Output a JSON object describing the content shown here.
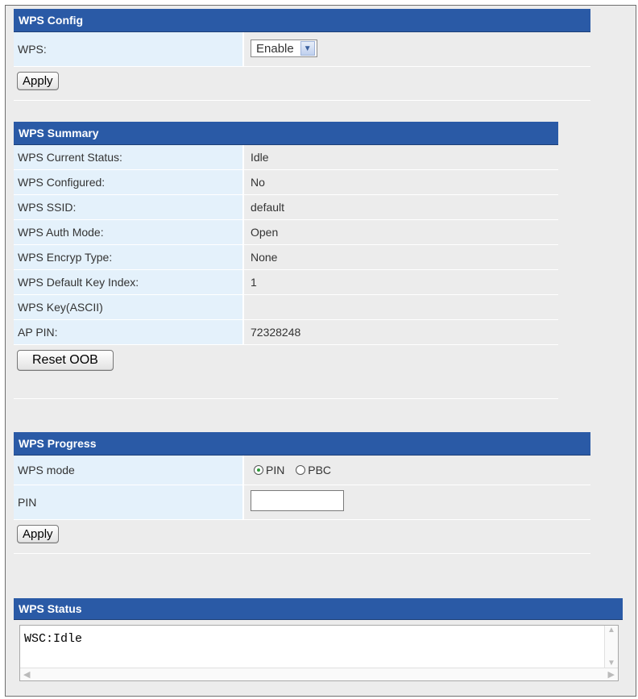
{
  "wps_config": {
    "title": "WPS Config",
    "wps_label": "WPS:",
    "wps_value": "Enable",
    "apply_label": "Apply"
  },
  "wps_summary": {
    "title": "WPS Summary",
    "rows": [
      {
        "label": "WPS Current Status:",
        "value": "Idle"
      },
      {
        "label": "WPS Configured:",
        "value": "No"
      },
      {
        "label": "WPS SSID:",
        "value": "default"
      },
      {
        "label": "WPS Auth Mode:",
        "value": "Open"
      },
      {
        "label": "WPS Encryp Type:",
        "value": "None"
      },
      {
        "label": "WPS Default Key Index:",
        "value": "1"
      },
      {
        "label": "WPS Key(ASCII)",
        "value": ""
      },
      {
        "label": "AP PIN:",
        "value": "72328248"
      }
    ],
    "reset_label": "Reset OOB"
  },
  "wps_progress": {
    "title": "WPS Progress",
    "mode_label": "WPS mode",
    "mode_options": [
      "PIN",
      "PBC"
    ],
    "mode_selected": "PIN",
    "pin_label": "PIN",
    "pin_value": "",
    "apply_label": "Apply"
  },
  "wps_status": {
    "title": "WPS Status",
    "text": "WSC:Idle"
  },
  "icons": {
    "dropdown": "chevron-down-icon",
    "scroll_up": "arrow-up-icon",
    "scroll_down": "arrow-down-icon",
    "scroll_left": "arrow-left-icon",
    "scroll_right": "arrow-right-icon"
  },
  "colors": {
    "header_bg": "#2a5aa6",
    "label_bg": "#e4f1fb",
    "value_bg": "#ececec"
  }
}
